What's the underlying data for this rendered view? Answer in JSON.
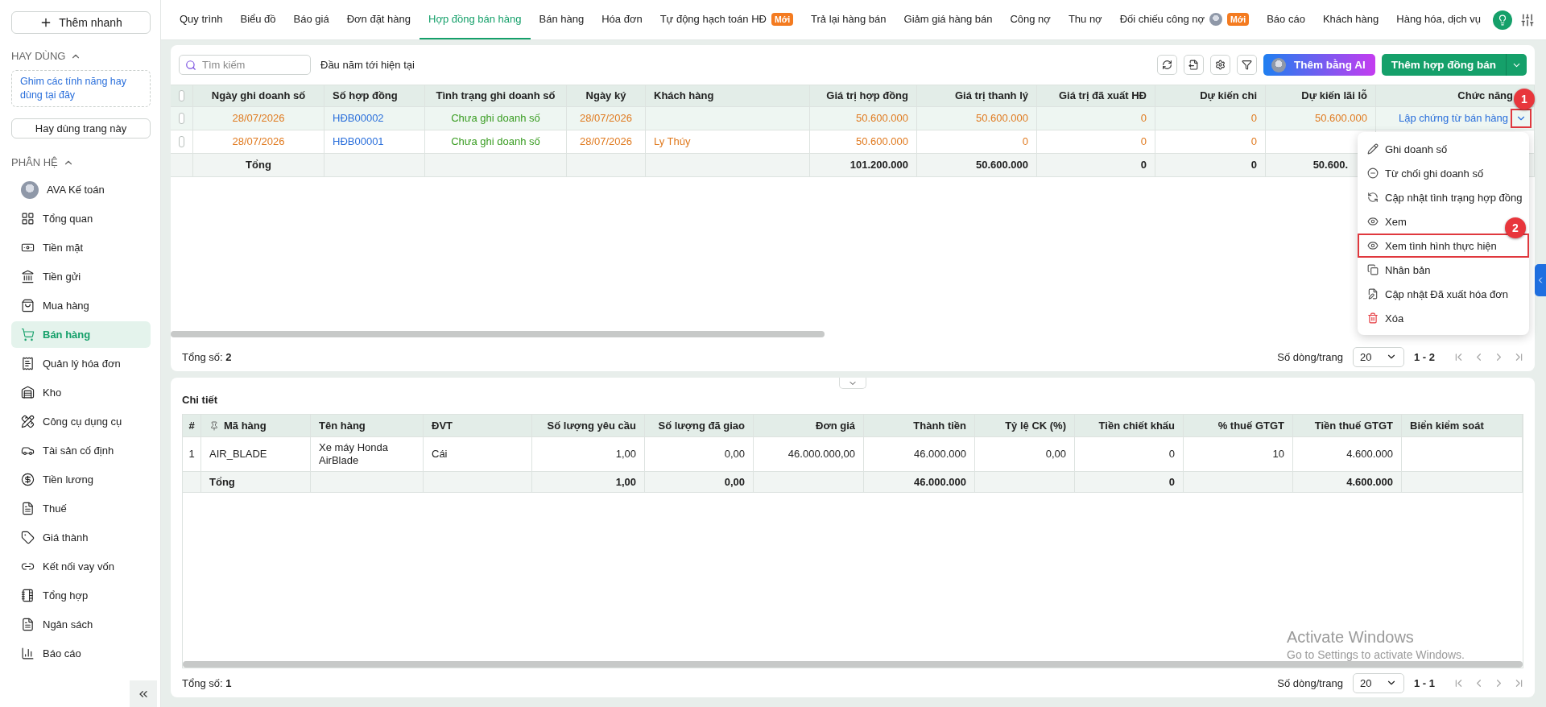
{
  "sidebar": {
    "quick_add": "Thêm nhanh",
    "favorites": {
      "title": "HAY DÙNG",
      "expanded": true,
      "hint": "Ghim các tính năng hay dùng tại đây",
      "button": "Hay dùng trang này"
    },
    "modules": {
      "title": "PHÂN HỆ",
      "expanded": true,
      "items": [
        {
          "label": "AVA Kế toán",
          "selected": false
        },
        {
          "label": "Tổng quan",
          "selected": false
        },
        {
          "label": "Tiền mặt",
          "selected": false
        },
        {
          "label": "Tiền gửi",
          "selected": false
        },
        {
          "label": "Mua hàng",
          "selected": false
        },
        {
          "label": "Bán hàng",
          "selected": true
        },
        {
          "label": "Quản lý hóa đơn",
          "selected": false
        },
        {
          "label": "Kho",
          "selected": false
        },
        {
          "label": "Công cụ dụng cụ",
          "selected": false
        },
        {
          "label": "Tài sản cố định",
          "selected": false
        },
        {
          "label": "Tiền lương",
          "selected": false
        },
        {
          "label": "Thuế",
          "selected": false
        },
        {
          "label": "Giá thành",
          "selected": false
        },
        {
          "label": "Kết nối vay vốn",
          "selected": false
        },
        {
          "label": "Tổng hợp",
          "selected": false
        },
        {
          "label": "Ngân sách",
          "selected": false
        },
        {
          "label": "Báo cáo",
          "selected": false
        }
      ]
    }
  },
  "tabs": [
    {
      "label": "Quy trình",
      "selected": false,
      "kind": "plain"
    },
    {
      "label": "Biểu đồ",
      "selected": false,
      "kind": "plain"
    },
    {
      "label": "Báo giá",
      "selected": false,
      "kind": "plain"
    },
    {
      "label": "Đơn đặt hàng",
      "selected": false,
      "kind": "plain"
    },
    {
      "label": "Hợp đồng bán hàng",
      "selected": true,
      "kind": "plain"
    },
    {
      "label": "Bán hàng",
      "selected": false,
      "kind": "plain"
    },
    {
      "label": "Hóa đơn",
      "selected": false,
      "kind": "plain"
    },
    {
      "label": "Tự động hạch toán HĐ",
      "selected": false,
      "kind": "badge",
      "badge": "Mới"
    },
    {
      "label": "Trả lại hàng bán",
      "selected": false,
      "kind": "plain"
    },
    {
      "label": "Giảm giá hàng bán",
      "selected": false,
      "kind": "plain"
    },
    {
      "label": "Công nợ",
      "selected": false,
      "kind": "plain"
    },
    {
      "label": "Thu nợ",
      "selected": false,
      "kind": "plain"
    },
    {
      "label": "Đối chiếu công nợ",
      "selected": false,
      "kind": "avatar_badge",
      "badge": "Mới"
    },
    {
      "label": "Báo cáo",
      "selected": false,
      "kind": "plain"
    },
    {
      "label": "Khách hàng",
      "selected": false,
      "kind": "plain"
    },
    {
      "label": "Hàng hóa, dịch vụ",
      "selected": false,
      "kind": "plain"
    }
  ],
  "toolbar": {
    "search": {
      "placeholder": "Tìm kiếm"
    },
    "period": "Đầu năm tới hiện tại",
    "ai_button": "Thêm bằng AI",
    "add_button": "Thêm hợp đồng bán"
  },
  "contracts": {
    "all_checked": false,
    "columns": [
      {
        "label": "Ngày ghi doanh số",
        "kind": "date"
      },
      {
        "label": "Số hợp đồng",
        "kind": "link"
      },
      {
        "label": "Tình trạng ghi doanh số",
        "kind": "status"
      },
      {
        "label": "Ngày ký",
        "kind": "date"
      },
      {
        "label": "Khách hàng",
        "kind": "party"
      },
      {
        "label": "Giá trị hợp đồng",
        "kind": "amount"
      },
      {
        "label": "Giá trị thanh lý",
        "kind": "amount"
      },
      {
        "label": "Giá trị đã xuất HĐ",
        "kind": "amount"
      },
      {
        "label": "Dự kiến chi",
        "kind": "amount"
      },
      {
        "label": "Dự kiến lãi lỗ",
        "kind": "amount"
      },
      {
        "label": "Chức năng",
        "kind": "action"
      }
    ],
    "rows": [
      {
        "selected": true,
        "checked": false,
        "marker": "1",
        "cells": [
          "28/07/2026",
          "HĐB00002",
          "Chưa ghi doanh số",
          "28/07/2026",
          null,
          "50.600.000",
          "50.600.000",
          "0",
          "0",
          "50.600.000",
          "Lập chứng từ bán hàng"
        ]
      },
      {
        "selected": false,
        "checked": false,
        "cells": [
          "28/07/2026",
          "HĐB00001",
          "Chưa ghi doanh số",
          "28/07/2026",
          "Ly Thúy",
          "50.600.000",
          "0",
          "0",
          "0",
          null,
          null
        ]
      }
    ],
    "total": {
      "label": "Tổng",
      "cells": [
        null,
        null,
        null,
        null,
        null,
        "101.200.000",
        "50.600.000",
        "0",
        "0",
        "50.600.",
        null
      ]
    },
    "footer": "Tổng số: **2**",
    "pagination": {
      "rows_label": "Số dòng/trang",
      "page_size": "20",
      "range": "1 - 2"
    }
  },
  "action_menu": {
    "items": [
      {
        "label": "Ghi doanh số",
        "kind": "edit"
      },
      {
        "label": "Từ chối ghi doanh số",
        "kind": "reject"
      },
      {
        "label": "Cập nhật tình trạng hợp đồng",
        "kind": "refresh"
      },
      {
        "label": "Xem",
        "kind": "view"
      },
      {
        "label": "Xem tình hình thực hiện",
        "kind": "view",
        "marker": "2"
      },
      {
        "label": "Nhân bản",
        "kind": "copy"
      },
      {
        "label": "Cập nhật Đã xuất hóa đơn",
        "kind": "file"
      },
      {
        "label": "Xóa",
        "kind": "delete"
      }
    ]
  },
  "detail": {
    "title": "Chi tiết",
    "expanded": true,
    "columns": [
      {
        "label": "#",
        "kind": "index"
      },
      {
        "label": "Mã hàng",
        "kind": "pinned"
      },
      {
        "label": "Tên hàng",
        "kind": "text"
      },
      {
        "label": "ĐVT",
        "kind": "text"
      },
      {
        "label": "Số lượng yêu cầu",
        "kind": "number"
      },
      {
        "label": "Số lượng đã giao",
        "kind": "number"
      },
      {
        "label": "Đơn giá",
        "kind": "number"
      },
      {
        "label": "Thành tiền",
        "kind": "number"
      },
      {
        "label": "Tỷ lệ CK (%)",
        "kind": "number"
      },
      {
        "label": "Tiền chiết khấu",
        "kind": "number"
      },
      {
        "label": "% thuế GTGT",
        "kind": "number"
      },
      {
        "label": "Tiền thuế GTGT",
        "kind": "number"
      },
      {
        "label": "Biển kiểm soát",
        "kind": "text"
      }
    ],
    "rows": [
      {
        "cells": [
          "1",
          "AIR_BLADE",
          "Xe máy Honda AirBlade",
          "Cái",
          "1,00",
          "0,00",
          "46.000.000,00",
          "46.000.000",
          "0,00",
          "0",
          "10",
          "4.600.000",
          null
        ]
      }
    ],
    "total": {
      "label": "Tổng",
      "cells": [
        null,
        null,
        null,
        null,
        "1,00",
        "0,00",
        null,
        "46.000.000",
        null,
        "0",
        null,
        "4.600.000",
        null
      ]
    },
    "footer": "Tổng số: **1**",
    "pagination": {
      "rows_label": "Số dòng/trang",
      "page_size": "20",
      "range": "1 - 1"
    }
  },
  "os_notice": {
    "title": "Activate Windows",
    "subtitle": "Go to Settings to activate Windows."
  }
}
